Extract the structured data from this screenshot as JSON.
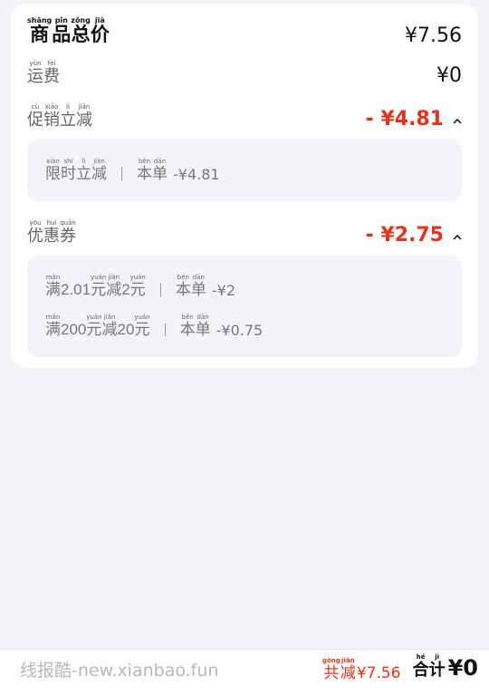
{
  "summary": {
    "total_label": [
      [
        "商",
        "shāng"
      ],
      [
        "品",
        "pǐn"
      ],
      [
        "总",
        "zǒng"
      ],
      [
        "价",
        "jià"
      ]
    ],
    "total_value": "¥7.56",
    "shipping_label": [
      [
        "运",
        "yùn"
      ],
      [
        "费",
        "fèi"
      ]
    ],
    "shipping_value": "¥0",
    "promo_label": [
      [
        "促",
        "cù"
      ],
      [
        "销",
        "xiāo"
      ],
      [
        "立",
        "lì"
      ],
      [
        "减",
        "jiǎn"
      ]
    ],
    "promo_value": "- ¥4.81",
    "promo_details": [
      {
        "name": [
          [
            "限",
            "xiàn"
          ],
          [
            "时",
            "shí"
          ],
          [
            "立",
            "lì"
          ],
          [
            "减",
            "jiǎn"
          ]
        ],
        "scope": [
          [
            "本",
            "běn"
          ],
          [
            "单",
            "dān"
          ]
        ],
        "amount": "-¥4.81"
      }
    ],
    "coupon_label": [
      [
        "优",
        "yōu"
      ],
      [
        "惠",
        "huì"
      ],
      [
        "券",
        "quàn"
      ]
    ],
    "coupon_value": "- ¥2.75",
    "coupon_details": [
      {
        "name": [
          [
            "满",
            "mǎn"
          ],
          [
            "2.01",
            ""
          ],
          [
            "元",
            "yuán"
          ],
          [
            "减",
            "jiǎn"
          ],
          [
            "2",
            ""
          ],
          [
            "元",
            "yuán"
          ]
        ],
        "scope": [
          [
            "本",
            "běn"
          ],
          [
            "单",
            "dān"
          ]
        ],
        "amount": "-¥2"
      },
      {
        "name": [
          [
            "满",
            "mǎn"
          ],
          [
            "200",
            ""
          ],
          [
            "元",
            "yuán"
          ],
          [
            "减",
            "jiǎn"
          ],
          [
            "20",
            ""
          ],
          [
            "元",
            "yuán"
          ]
        ],
        "scope": [
          [
            "本",
            "běn"
          ],
          [
            "单",
            "dān"
          ]
        ],
        "amount": "-¥0.75"
      }
    ]
  },
  "footer": {
    "watermark": "线报酷-new.xianbao.fun",
    "discount_label": [
      [
        "共",
        "gòng"
      ],
      [
        "减",
        "jiǎn"
      ]
    ],
    "discount_value": "¥7.56",
    "total_label": [
      [
        "合",
        "hé"
      ],
      [
        "计",
        "jì"
      ]
    ],
    "total_value": "¥0"
  },
  "colors": {
    "accent_red": "#e8331c",
    "background": "#f3f4f8",
    "card": "#ffffff"
  },
  "icons": {
    "expand_promo": "chevron-up-icon",
    "expand_coupon": "chevron-up-icon"
  }
}
